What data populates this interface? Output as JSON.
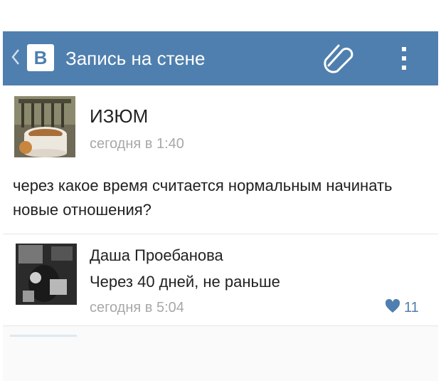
{
  "appbar": {
    "logo_text": "В",
    "title": "Запись на стене",
    "color": "#4f7fae",
    "icons": [
      "chevron-left-icon",
      "attach-icon",
      "more-vertical-icon"
    ]
  },
  "post": {
    "author": "ИЗЮМ",
    "time": "сегодня в 1:40",
    "text": "через какое время считается нормальным начинать новые отношения?"
  },
  "comment": {
    "author": "Даша Проебанова",
    "text": "Через 40 дней, не раньше",
    "time": "сегодня в 5:04",
    "likes": "11"
  }
}
